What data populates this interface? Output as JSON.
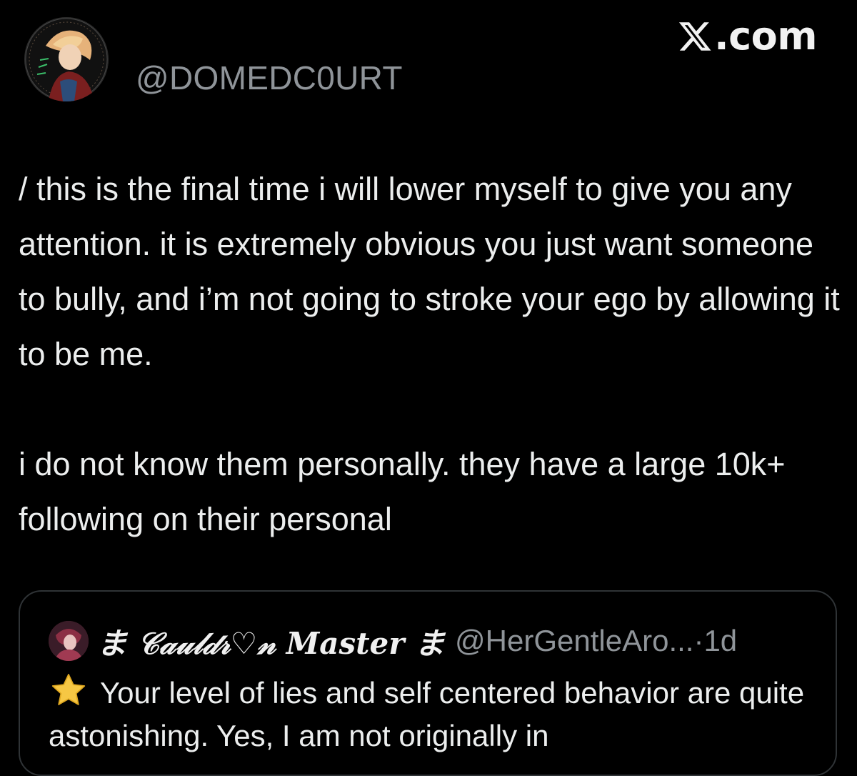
{
  "header": {
    "handle": "@DOMEDC0URT",
    "brand_text": ".com",
    "brand_icon": "x-logo-icon"
  },
  "post": {
    "paragraph_1": "/ this is the final time i will lower myself to give you any attention. it is extremely obvious you just want someone to bully, and i’m not going to stroke your ego by allowing it to be me.",
    "paragraph_2": "i do not know them personally. they have a large 10k+ following on their personal"
  },
  "quote": {
    "display_name": "ま 𝒞𝒶𝓊𝓁𝒹𝓇♡𝓃 Master ま",
    "handle": "@HerGentleAro...",
    "separator": " · ",
    "time": "1d",
    "star_icon": "star-emoji-icon",
    "text": "Your level of lies and self centered behavior are quite astonishing. Yes, I am not originally in"
  },
  "colors": {
    "background": "#000000",
    "text_primary": "#eceeee",
    "text_secondary": "#8f9499",
    "card_border": "#2f3336",
    "star": "#f6c744"
  }
}
